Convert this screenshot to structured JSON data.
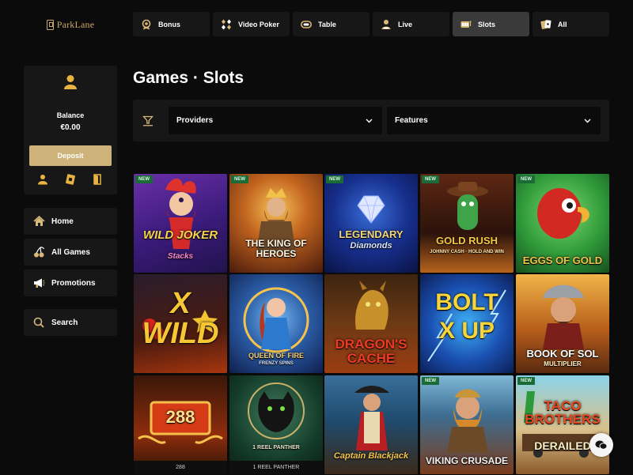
{
  "brand": {
    "logo_text": "ParkLane"
  },
  "topnav": [
    {
      "label": "Bonus",
      "icon": "bonus-icon"
    },
    {
      "label": "Video Poker",
      "icon": "video-poker-icon"
    },
    {
      "label": "Table",
      "icon": "table-games-icon"
    },
    {
      "label": "Live",
      "icon": "live-dealer-icon"
    },
    {
      "label": "Slots",
      "icon": "slots-icon",
      "active": true
    },
    {
      "label": "All",
      "icon": "all-games-icon"
    }
  ],
  "account": {
    "balance_label": "Balance",
    "balance_value": "€0.00",
    "deposit_label": "Deposit"
  },
  "sidebar": [
    {
      "label": "Home",
      "icon": "home-icon"
    },
    {
      "label": "All Games",
      "icon": "cherries-icon"
    },
    {
      "label": "Promotions",
      "icon": "megaphone-icon"
    },
    {
      "label": "Search",
      "icon": "search-icon"
    }
  ],
  "page": {
    "title": "Games · Slots"
  },
  "filters": {
    "providers_label": "Providers",
    "features_label": "Features"
  },
  "badge_text": "NEW",
  "games": [
    {
      "title": "WILD JOKER",
      "subtitle": "Stacks",
      "is_new": true
    },
    {
      "title": "THE KING OF HEROES",
      "subtitle": "",
      "is_new": true
    },
    {
      "title": "LEGENDARY",
      "subtitle": "Diamonds",
      "is_new": true
    },
    {
      "title": "GOLD RUSH",
      "subtitle": "JOHNNY CASH · HOLD AND WIN",
      "is_new": true
    },
    {
      "title": "EGGS OF GOLD",
      "subtitle": "",
      "is_new": true
    },
    {
      "title": "X WILD",
      "subtitle": "",
      "is_new": false
    },
    {
      "title": "QUEEN OF FIRE",
      "subtitle": "FRENZY SPINS",
      "is_new": false
    },
    {
      "title": "DRAGON'S CACHE",
      "subtitle": "",
      "is_new": false
    },
    {
      "title": "BOLT X UP",
      "subtitle": "",
      "is_new": false
    },
    {
      "title": "BOOK OF SOL",
      "subtitle": "MULTIPLIER",
      "is_new": false
    },
    {
      "title": "288",
      "subtitle": "",
      "caption": "288",
      "is_new": false
    },
    {
      "title": "1 REEL PANTHER",
      "subtitle": "",
      "caption": "1 REEL PANTHER",
      "is_new": false
    },
    {
      "title": "Captain Blackjack",
      "subtitle": "",
      "is_new": false
    },
    {
      "title": "VIKING CRUSADE",
      "subtitle": "",
      "is_new": true
    },
    {
      "title": "TACO BROTHERS",
      "subtitle": "DERAILED",
      "is_new": true
    }
  ],
  "colors": {
    "accent_gold": "#cdb27a",
    "panel": "#171717",
    "background": "#0b0b0b",
    "badge_green": "#1b6b38"
  }
}
